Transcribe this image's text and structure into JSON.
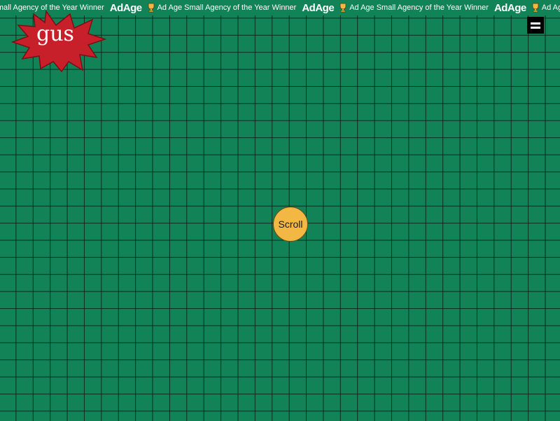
{
  "ticker": {
    "segments": [
      {
        "logo": "AdAge",
        "text": "Ad Age Small Agency of the Year Winner"
      },
      {
        "logo": "AdAge",
        "text": "Ad Age Small Agency of the Year Winner"
      },
      {
        "logo": "AdAge",
        "text": "Ad Age Small Agency of the Year Winner"
      },
      {
        "logo": "AdAge",
        "text": "Ad Age Small Agency of the Year Winner"
      }
    ]
  },
  "brand": {
    "logo_text": "gus",
    "burst_color": "#c8202a"
  },
  "menu": {
    "icon": "hamburger-icon"
  },
  "scroll": {
    "label": "Scroll"
  },
  "colors": {
    "background": "#118357",
    "grid_line": "#0a1e14",
    "scroll_fill": "#f3b843",
    "ticker_text": "#ffffff"
  }
}
